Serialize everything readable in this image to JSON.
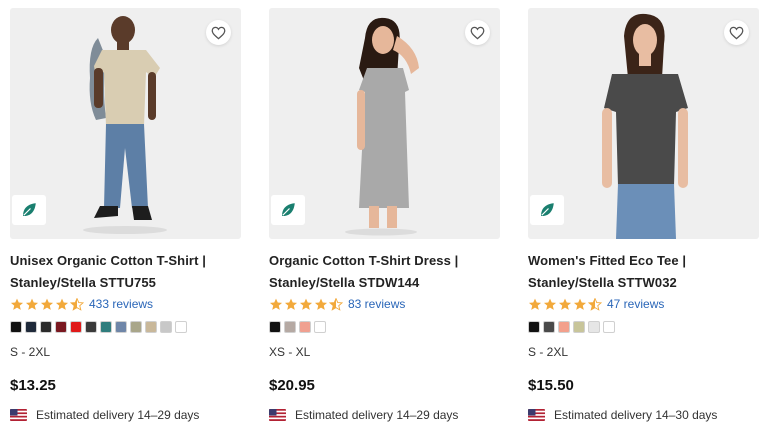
{
  "products": [
    {
      "title_line1": "Unisex Organic Cotton T-Shirt |",
      "title_line2": "Stanley/Stella STTU755",
      "rating": 4.5,
      "reviews": "433 reviews",
      "colors": [
        "#111111",
        "#1f2a3a",
        "#2b2b2b",
        "#7a1820",
        "#e01a1a",
        "#3a3a3a",
        "#2f7d7d",
        "#6f86a8",
        "#a9a68a",
        "#c9b89a",
        "#c8c8c8",
        "#ffffff"
      ],
      "sizes": "S - 2XL",
      "price": "$13.25",
      "delivery": "Estimated delivery 14–29 days"
    },
    {
      "title_line1": "Organic Cotton T-Shirt Dress |",
      "title_line2": "Stanley/Stella STDW144",
      "rating": 4.5,
      "reviews": "83 reviews",
      "colors": [
        "#111111",
        "#b5a9a3",
        "#f0a090",
        "#ffffff"
      ],
      "sizes": "XS - XL",
      "price": "$20.95",
      "delivery": "Estimated delivery 14–29 days"
    },
    {
      "title_line1": "Women's Fitted Eco Tee |",
      "title_line2": "Stanley/Stella STTW032",
      "rating": 4.5,
      "reviews": "47 reviews",
      "colors": [
        "#111111",
        "#4a4a4a",
        "#f3a08c",
        "#c8c59a",
        "#e6e6e6",
        "#ffffff"
      ],
      "sizes": "S - 2XL",
      "price": "$15.50",
      "delivery": "Estimated delivery 14–30 days"
    }
  ],
  "icons": {
    "favorite": "heart-outline-icon",
    "eco": "leaf-icon",
    "rating": "star-icon",
    "flag": "us-flag-icon"
  },
  "colors": {
    "star": "#f2a93b",
    "link": "#2a66b8",
    "eco": "#1a7f6f"
  }
}
